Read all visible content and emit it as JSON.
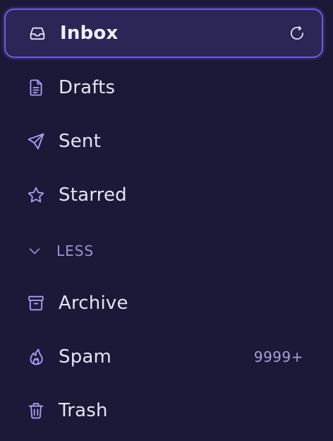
{
  "colors": {
    "background": "#1c1838",
    "active_background": "#2b2656",
    "active_border": "#6b5ed8",
    "icon": "#a99ef0",
    "text": "#e6e3f5",
    "muted": "#9b93cf"
  },
  "nav": {
    "inbox": {
      "label": "Inbox",
      "icon": "inbox-icon",
      "active": true,
      "action_icon": "refresh-icon"
    },
    "drafts": {
      "label": "Drafts",
      "icon": "file-icon"
    },
    "sent": {
      "label": "Sent",
      "icon": "send-icon"
    },
    "starred": {
      "label": "Starred",
      "icon": "star-icon"
    },
    "toggle": {
      "label": "LESS",
      "icon": "chevron-down-icon"
    },
    "archive": {
      "label": "Archive",
      "icon": "archive-icon"
    },
    "spam": {
      "label": "Spam",
      "icon": "flame-icon",
      "count": "9999+"
    },
    "trash": {
      "label": "Trash",
      "icon": "trash-icon"
    }
  }
}
